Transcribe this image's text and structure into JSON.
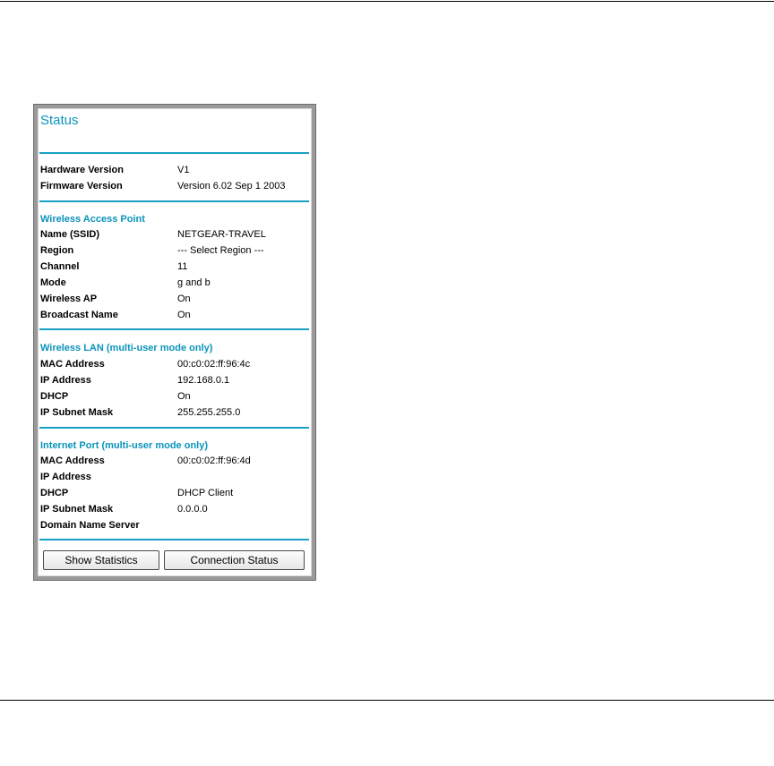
{
  "status": {
    "title": "Status",
    "sections": [
      {
        "heading": "",
        "rows": [
          {
            "label": "Hardware Version",
            "value": "V1"
          },
          {
            "label": "Firmware Version",
            "value": "Version 6.02 Sep 1 2003"
          }
        ]
      },
      {
        "heading": "Wireless Access Point",
        "rows": [
          {
            "label": "Name (SSID)",
            "value": "NETGEAR-TRAVEL"
          },
          {
            "label": "Region",
            "value": "--- Select Region ---"
          },
          {
            "label": "Channel",
            "value": "11"
          },
          {
            "label": "Mode",
            "value": "g and b"
          },
          {
            "label": "Wireless AP",
            "value": "On"
          },
          {
            "label": "Broadcast Name",
            "value": "On"
          }
        ]
      },
      {
        "heading": "Wireless LAN (multi-user mode only)",
        "rows": [
          {
            "label": "MAC Address",
            "value": "00:c0:02:ff:96:4c"
          },
          {
            "label": "IP Address",
            "value": "192.168.0.1"
          },
          {
            "label": "DHCP",
            "value": "On"
          },
          {
            "label": "IP Subnet Mask",
            "value": "255.255.255.0"
          }
        ]
      },
      {
        "heading": "Internet Port (multi-user mode only)",
        "rows": [
          {
            "label": "MAC Address",
            "value": "00:c0:02:ff:96:4d"
          },
          {
            "label": "IP Address",
            "value": ""
          },
          {
            "label": "DHCP",
            "value": "DHCP Client"
          },
          {
            "label": "IP Subnet Mask",
            "value": "0.0.0.0"
          },
          {
            "label": "Domain Name Server",
            "value": ""
          }
        ]
      }
    ],
    "buttons": {
      "show_statistics": "Show Statistics",
      "connection_status": "Connection Status"
    }
  },
  "colors": {
    "accent": "#0a93bb",
    "divider": "#1aa0c6",
    "frame": "#9a9a9a"
  }
}
